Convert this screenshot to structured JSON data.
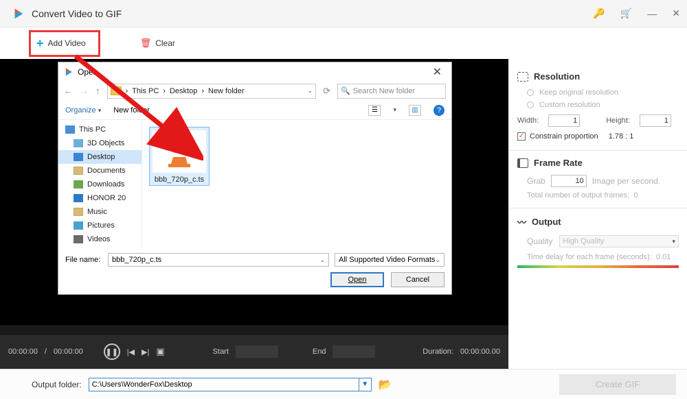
{
  "app": {
    "title": "Convert Video to GIF"
  },
  "toolbar": {
    "add_video": "Add Video",
    "clear": "Clear"
  },
  "sidepanel": {
    "resolution": {
      "title": "Resolution",
      "keep_original": "Keep original resolution",
      "custom": "Custom resolution",
      "width_label": "Width:",
      "width_value": "1",
      "height_label": "Height:",
      "height_value": "1",
      "constrain": "Constrain proportion",
      "ratio": "1.78 : 1"
    },
    "framerate": {
      "title": "Frame Rate",
      "grab_label": "Grab",
      "grab_value": "10",
      "unit": "Image per second.",
      "total_label": "Total number of output frames:",
      "total_value": "0"
    },
    "output": {
      "title": "Output",
      "quality_label": "Quality",
      "quality_value": "High Quality",
      "delay_label": "Time delay for each frame (seconds):",
      "delay_value": "0.01"
    }
  },
  "player": {
    "time_current": "00:00:00",
    "time_total": "00:00:00",
    "start_label": "Start",
    "end_label": "End",
    "duration_label": "Duration:",
    "duration_value": "00:00:00.00"
  },
  "footer": {
    "output_folder_label": "Output folder:",
    "output_folder_value": "C:\\Users\\WonderFox\\Desktop",
    "create_gif": "Create GIF"
  },
  "dialog": {
    "title": "Open",
    "breadcrumb": [
      "This PC",
      "Desktop",
      "New folder"
    ],
    "search_placeholder": "Search New folder",
    "organize": "Organize",
    "new_folder": "New folder",
    "tree": [
      {
        "label": "This PC",
        "type": "root"
      },
      {
        "label": "3D Objects",
        "type": "child"
      },
      {
        "label": "Desktop",
        "type": "child",
        "selected": true
      },
      {
        "label": "Documents",
        "type": "child"
      },
      {
        "label": "Downloads",
        "type": "child"
      },
      {
        "label": "HONOR 20",
        "type": "child"
      },
      {
        "label": "Music",
        "type": "child"
      },
      {
        "label": "Pictures",
        "type": "child"
      },
      {
        "label": "Videos",
        "type": "child"
      }
    ],
    "file": {
      "name": "bbb_720p_c.ts"
    },
    "file_name_label": "File name:",
    "file_name_value": "bbb_720p_c.ts",
    "format_filter": "All Supported Video Formats(*.:",
    "open_btn": "Open",
    "cancel_btn": "Cancel"
  }
}
